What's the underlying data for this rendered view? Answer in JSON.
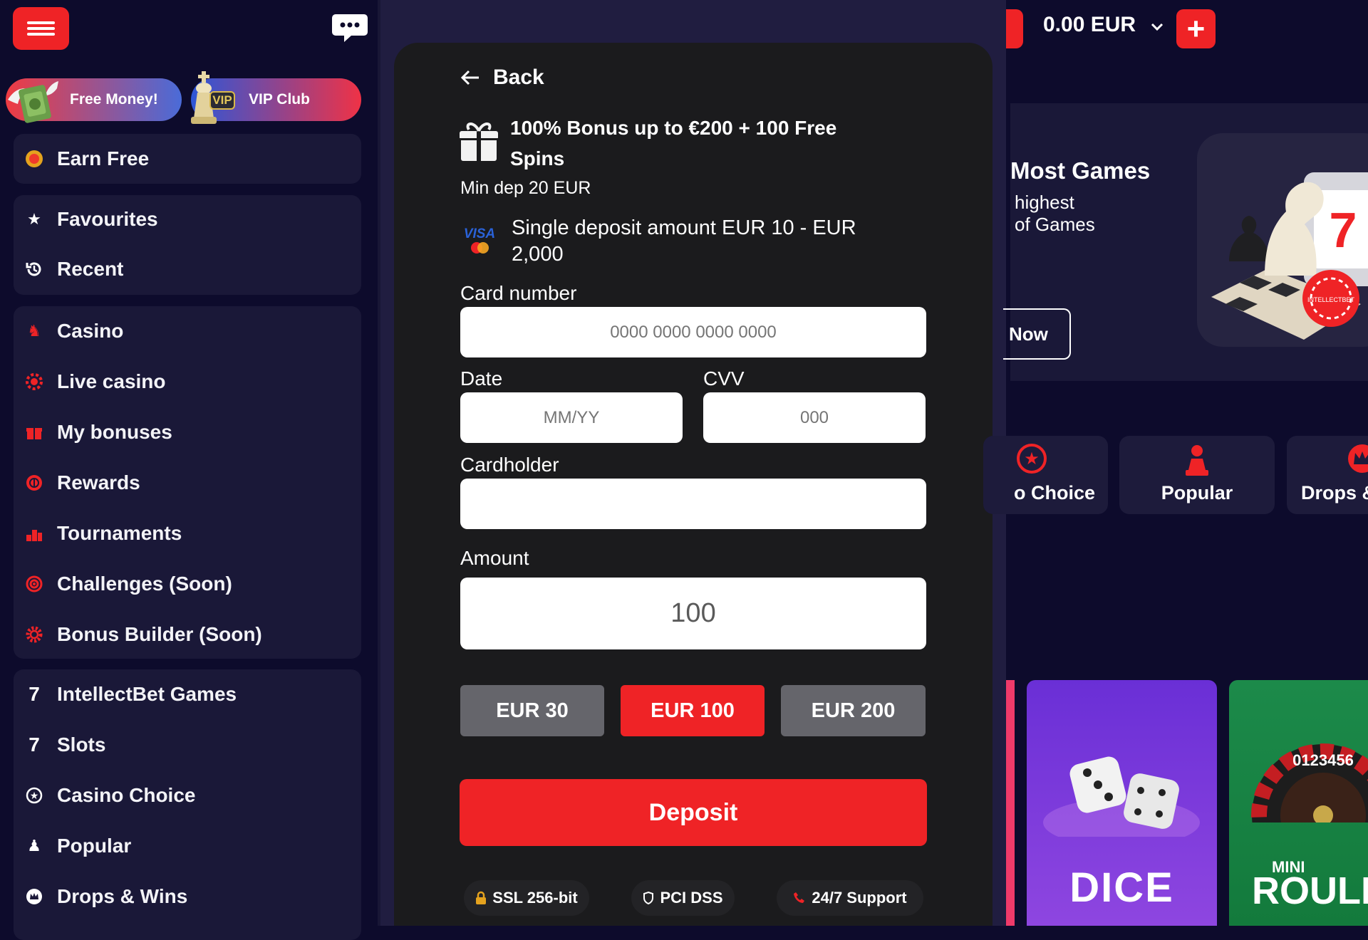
{
  "sidebar": {
    "promos": [
      {
        "label": "Free Money!"
      },
      {
        "label": "VIP Club",
        "badge": "VIP"
      }
    ],
    "groups": [
      {
        "items": [
          {
            "label": "Earn Free",
            "icon": "coin-icon"
          }
        ]
      },
      {
        "items": [
          {
            "label": "Favourites",
            "icon": "star-icon"
          },
          {
            "label": "Recent",
            "icon": "history-icon"
          }
        ]
      },
      {
        "items": [
          {
            "label": "Casino",
            "icon": "chess-knight-icon"
          },
          {
            "label": "Live casino",
            "icon": "live-casino-icon"
          },
          {
            "label": "My bonuses",
            "icon": "gift-icon"
          },
          {
            "label": "Rewards",
            "icon": "rewards-icon"
          },
          {
            "label": "Tournaments",
            "icon": "podium-icon"
          },
          {
            "label": "Challenges (Soon)",
            "icon": "target-icon"
          },
          {
            "label": "Bonus Builder (Soon)",
            "icon": "gear-icon"
          }
        ]
      },
      {
        "items": [
          {
            "label": "IntellectBet Games",
            "icon": "seven-icon"
          },
          {
            "label": "Slots",
            "icon": "seven-icon"
          },
          {
            "label": "Casino Choice",
            "icon": "star-badge-icon"
          },
          {
            "label": "Popular",
            "icon": "pawn-icon"
          },
          {
            "label": "Drops & Wins",
            "icon": "crown-icon"
          }
        ]
      }
    ]
  },
  "deposit": {
    "back_label": "Back",
    "bonus_title": "100% Bonus up to €200 + 100 Free Spins",
    "min_dep": "Min dep 20 EUR",
    "single_deposit": "Single deposit amount EUR 10 - EUR 2,000",
    "card_number_label": "Card number",
    "card_number_placeholder": "0000 0000 0000 0000",
    "date_label": "Date",
    "date_placeholder": "MM/YY",
    "cvv_label": "CVV",
    "cvv_placeholder": "000",
    "cardholder_label": "Cardholder",
    "amount_label": "Amount",
    "amount_value": "100",
    "chips": [
      {
        "label": "EUR 30"
      },
      {
        "label": "EUR 100"
      },
      {
        "label": "EUR 200"
      }
    ],
    "deposit_label": "Deposit",
    "trust": [
      {
        "label": "SSL 256-bit",
        "icon": "lock-icon"
      },
      {
        "label": "PCI DSS",
        "icon": "shield-icon"
      },
      {
        "label": "24/7 Support",
        "icon": "phone-icon"
      }
    ]
  },
  "header": {
    "balance": "0.00 EUR",
    "add_label": "+"
  },
  "banner": {
    "title": "Most Games",
    "line1": "highest",
    "line2": "of Games",
    "cta": "Now",
    "chip_label": "INTELLECTBET"
  },
  "categories": [
    {
      "label": "o Choice"
    },
    {
      "label": "Popular"
    },
    {
      "label": "Drops &"
    }
  ],
  "games": [
    {
      "label": "DICE"
    },
    {
      "label_top": "MINI",
      "label": "ROULETT",
      "wheel_digits": "0123456"
    }
  ],
  "colors": {
    "accent": "#ef2326",
    "bg": "#0d0b2c",
    "panel": "#1a1838",
    "modal": "#1b1b1d"
  }
}
